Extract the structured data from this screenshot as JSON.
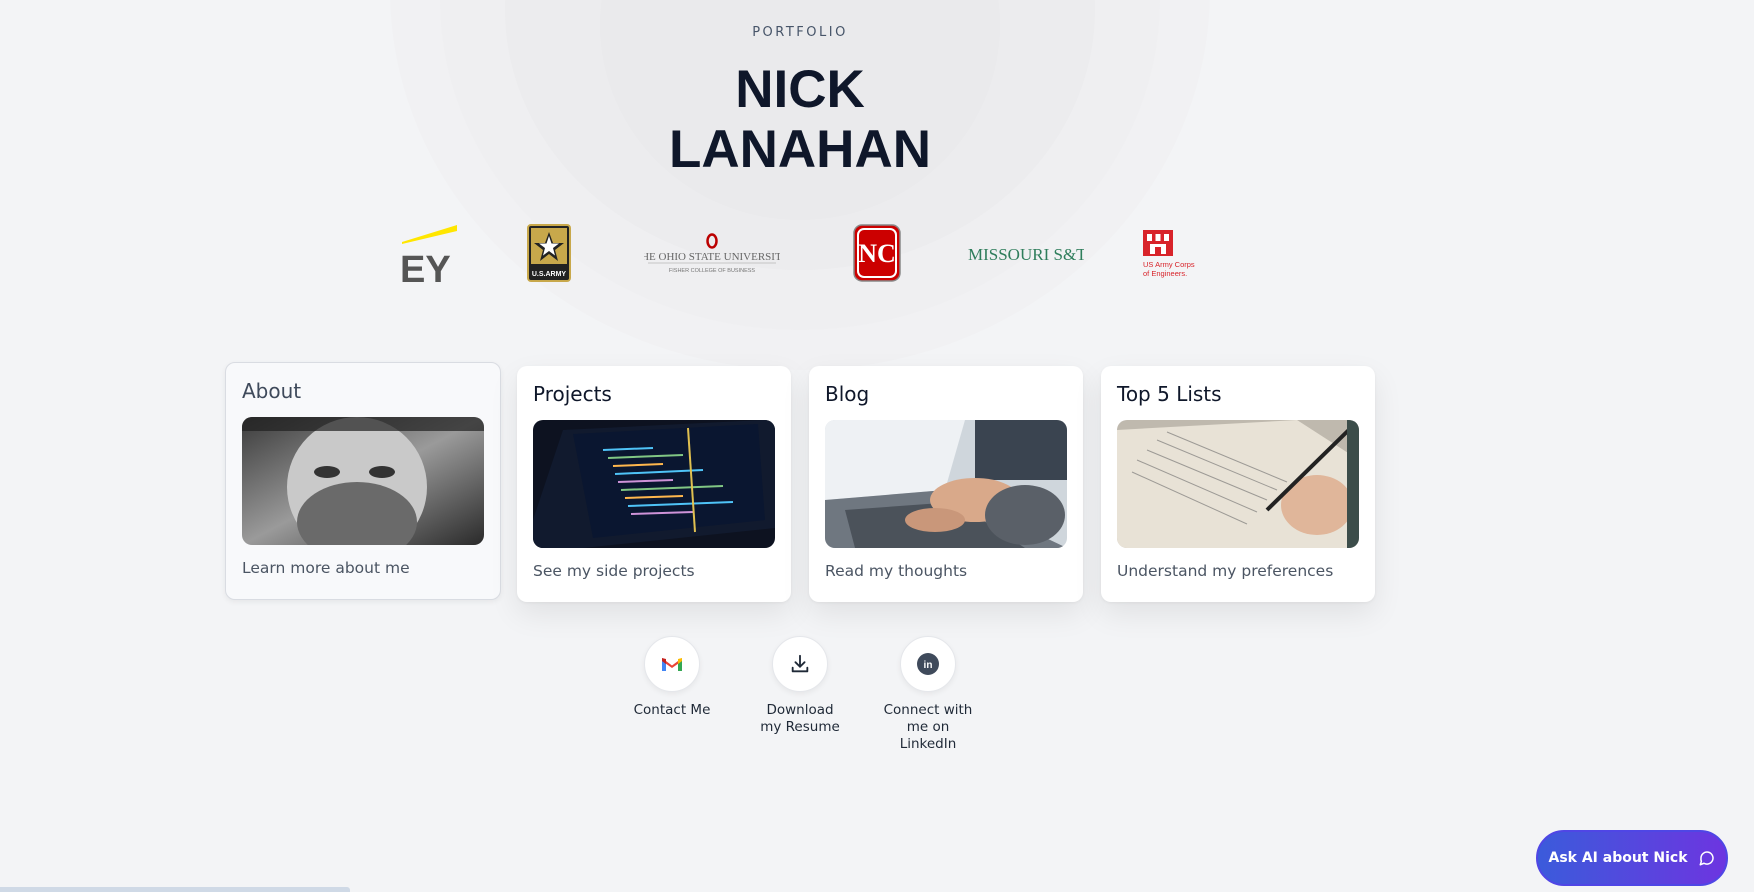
{
  "header": {
    "kicker": "PORTFOLIO",
    "name_line1": "NICK",
    "name_line2": "LANAHAN"
  },
  "logos": {
    "ey": {
      "text": "EY",
      "name": "EY"
    },
    "army": {
      "text": "U.S.ARMY",
      "name": "U.S. Army"
    },
    "osu": {
      "line1": "THE OHIO STATE UNIVERSITY",
      "line2": "FISHER COLLEGE OF BUSINESS"
    },
    "ncstate": {
      "text": "NC",
      "name": "NC State"
    },
    "mst": {
      "text": "MISSOURI S&T"
    },
    "usace": {
      "line1": "US Army Corps",
      "line2": "of Engineers."
    }
  },
  "cards": [
    {
      "title": "About",
      "description": "Learn more about me",
      "image": "portrait-photo"
    },
    {
      "title": "Projects",
      "description": "See my side projects",
      "image": "code-laptop-photo"
    },
    {
      "title": "Blog",
      "description": "Read my thoughts",
      "image": "typing-laptop-photo"
    },
    {
      "title": "Top 5 Lists",
      "description": "Understand my preferences",
      "image": "writing-notebook-photo"
    }
  ],
  "actions": [
    {
      "label": "Contact Me",
      "icon": "gmail-icon"
    },
    {
      "label": "Download my Resume",
      "icon": "download-icon"
    },
    {
      "label": "Connect with me on LinkedIn",
      "icon": "linkedin-icon"
    }
  ],
  "ai_button": {
    "label": "Ask AI about Nick",
    "icon": "chat-bubble-icon"
  },
  "colors": {
    "background": "#f3f4f6",
    "title": "#0f172a",
    "ai_gradient_start": "#3b5bdb",
    "ai_gradient_end": "#6d35e0",
    "ey_yellow": "#ffe600",
    "ncstate_red": "#cc0000"
  }
}
